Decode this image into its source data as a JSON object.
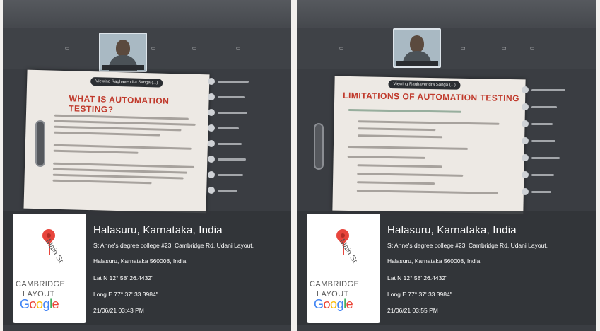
{
  "photos": [
    {
      "meeting": {
        "slide_title": "WHAT IS AUTOMATION TESTING?",
        "presenter_pill": "Viewing Raghavendra Sanga (...)"
      },
      "geotag": {
        "title": "Halasuru, Karnataka, India",
        "address_line1": "St Anne's degree college #23, Cambridge Rd, Udani Layout,",
        "address_line2": "Halasuru, Karnataka 560008, India",
        "lat": "Lat N 12° 58' 26.4432\"",
        "long": "Long E 77° 37' 33.3984\"",
        "datetime": "21/06/21 03:43 PM",
        "map": {
          "street": "Main St",
          "area_line1": "CAMBRIDGE",
          "area_line2": "LAYOUT",
          "logo": "Google"
        }
      }
    },
    {
      "meeting": {
        "slide_title": "LIMITATIONS OF AUTOMATION TESTING",
        "presenter_pill": "Viewing Raghavendra Sanga (...)"
      },
      "geotag": {
        "title": "Halasuru, Karnataka, India",
        "address_line1": "St Anne's degree college #23, Cambridge Rd, Udani Layout,",
        "address_line2": "Halasuru, Karnataka 560008, India",
        "lat": "Lat N 12° 58' 26.4432\"",
        "long": "Long E 77° 37' 33.3984\"",
        "datetime": "21/06/21 03:55 PM",
        "map": {
          "street": "Main St",
          "area_line1": "CAMBRIDGE",
          "area_line2": "LAYOUT",
          "logo": "Google"
        }
      }
    }
  ],
  "colors": {
    "slide_title": "#c0392b",
    "pin": "#e8453c",
    "overlay": "#323438"
  }
}
